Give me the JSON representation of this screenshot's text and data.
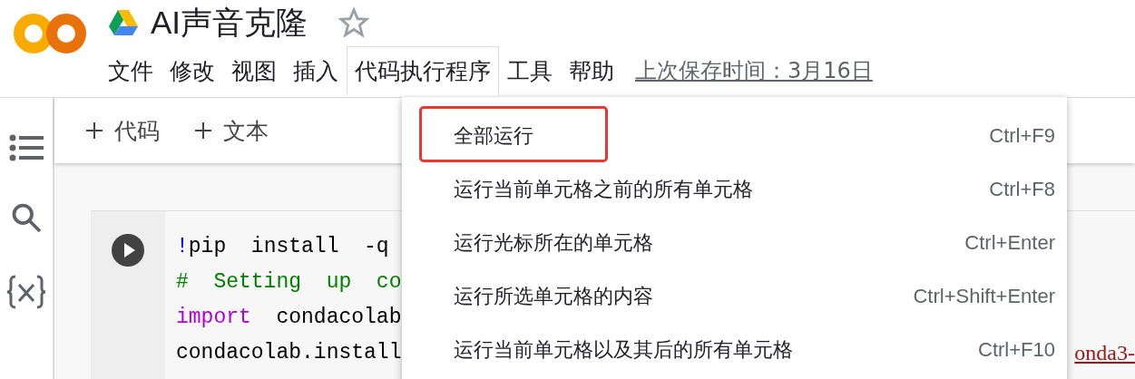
{
  "notebook": {
    "title": "AI声音克隆",
    "starred": false
  },
  "menu": [
    {
      "label": "文件",
      "selected": false
    },
    {
      "label": "修改",
      "selected": false
    },
    {
      "label": "视图",
      "selected": false
    },
    {
      "label": "插入",
      "selected": false
    },
    {
      "label": "代码执行程序",
      "selected": true
    },
    {
      "label": "工具",
      "selected": false
    },
    {
      "label": "帮助",
      "selected": false
    }
  ],
  "last_saved": "上次保存时间：3月16日",
  "toolbar": [
    "代码",
    "文本"
  ],
  "code_cell": {
    "lines": [
      [
        {
          "kind": "bang",
          "text": "!"
        },
        {
          "kind": "plain",
          "text": "pip  install  -q"
        }
      ],
      [
        {
          "kind": "comment",
          "text": "#  Setting  up  co"
        }
      ],
      [
        {
          "kind": "keyword",
          "text": "import"
        },
        {
          "kind": "plain",
          "text": "  condacolab"
        }
      ],
      [
        {
          "kind": "plain",
          "text": "condacolab.install"
        }
      ]
    ],
    "trailing_link": "onda3-"
  },
  "dropdown": [
    {
      "label": "全部运行",
      "shortcut": "Ctrl+F9",
      "highlighted": true
    },
    {
      "label": "运行当前单元格之前的所有单元格",
      "shortcut": "Ctrl+F8",
      "highlighted": false
    },
    {
      "label": "运行光标所在的单元格",
      "shortcut": "Ctrl+Enter",
      "highlighted": false
    },
    {
      "label": "运行所选单元格的内容",
      "shortcut": "Ctrl+Shift+Enter",
      "highlighted": false
    },
    {
      "label": "运行当前单元格以及其后的所有单元格",
      "shortcut": "Ctrl+F10",
      "highlighted": false
    }
  ]
}
